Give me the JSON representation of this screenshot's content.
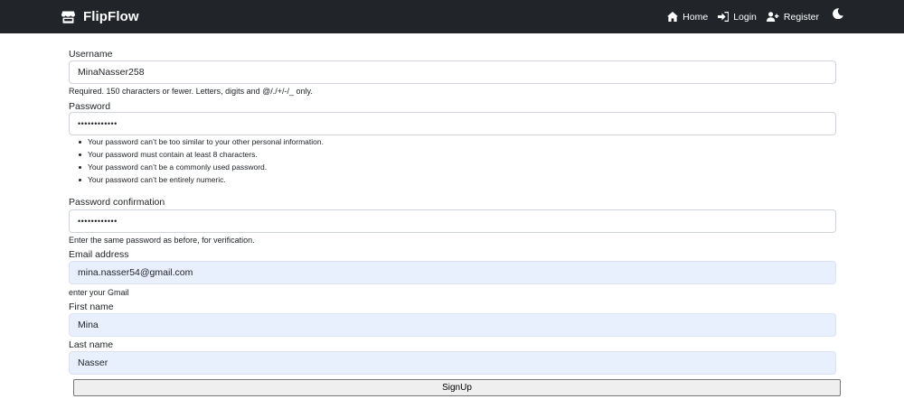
{
  "navbar": {
    "brand": "FlipFlow",
    "links": [
      {
        "label": "Home",
        "icon": "home-icon"
      },
      {
        "label": "Login",
        "icon": "login-icon"
      },
      {
        "label": "Register",
        "icon": "user-plus-icon"
      }
    ],
    "theme_icon": "moon-icon"
  },
  "form": {
    "username": {
      "label": "Username",
      "value": "MinaNasser258",
      "help": "Required. 150 characters or fewer. Letters, digits and @/./+/-/_ only."
    },
    "password": {
      "label": "Password",
      "value": "••••••••••••",
      "help": [
        "Your password can’t be too similar to your other personal information.",
        "Your password must contain at least 8 characters.",
        "Your password can’t be a commonly used password.",
        "Your password can’t be entirely numeric."
      ]
    },
    "password_confirmation": {
      "label": "Password confirmation",
      "value": "••••••••••••",
      "help": "Enter the same password as before, for verification."
    },
    "email": {
      "label": "Email address",
      "value": "mina.nasser54@gmail.com",
      "help": "enter your Gmail"
    },
    "first_name": {
      "label": "First name",
      "value": "Mina"
    },
    "last_name": {
      "label": "Last name",
      "value": "Nasser"
    },
    "submit_label": "SignUp"
  }
}
